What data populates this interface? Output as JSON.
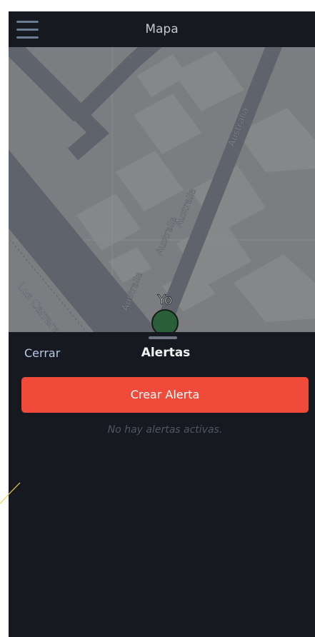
{
  "header": {
    "title": "Mapa",
    "menu_icon": "hamburger-menu-icon"
  },
  "map": {
    "streets": [
      "Australia",
      "Australia",
      "Australia",
      "Australia",
      "Los Carrera"
    ],
    "user_marker": {
      "label": "Yo",
      "color": "#2b5f3a"
    }
  },
  "alerts_sheet": {
    "close_label": "Cerrar",
    "title": "Alertas",
    "create_button_label": "Crear Alerta",
    "empty_message": "No hay alertas activas.",
    "accent_color": "#f04a3a"
  }
}
